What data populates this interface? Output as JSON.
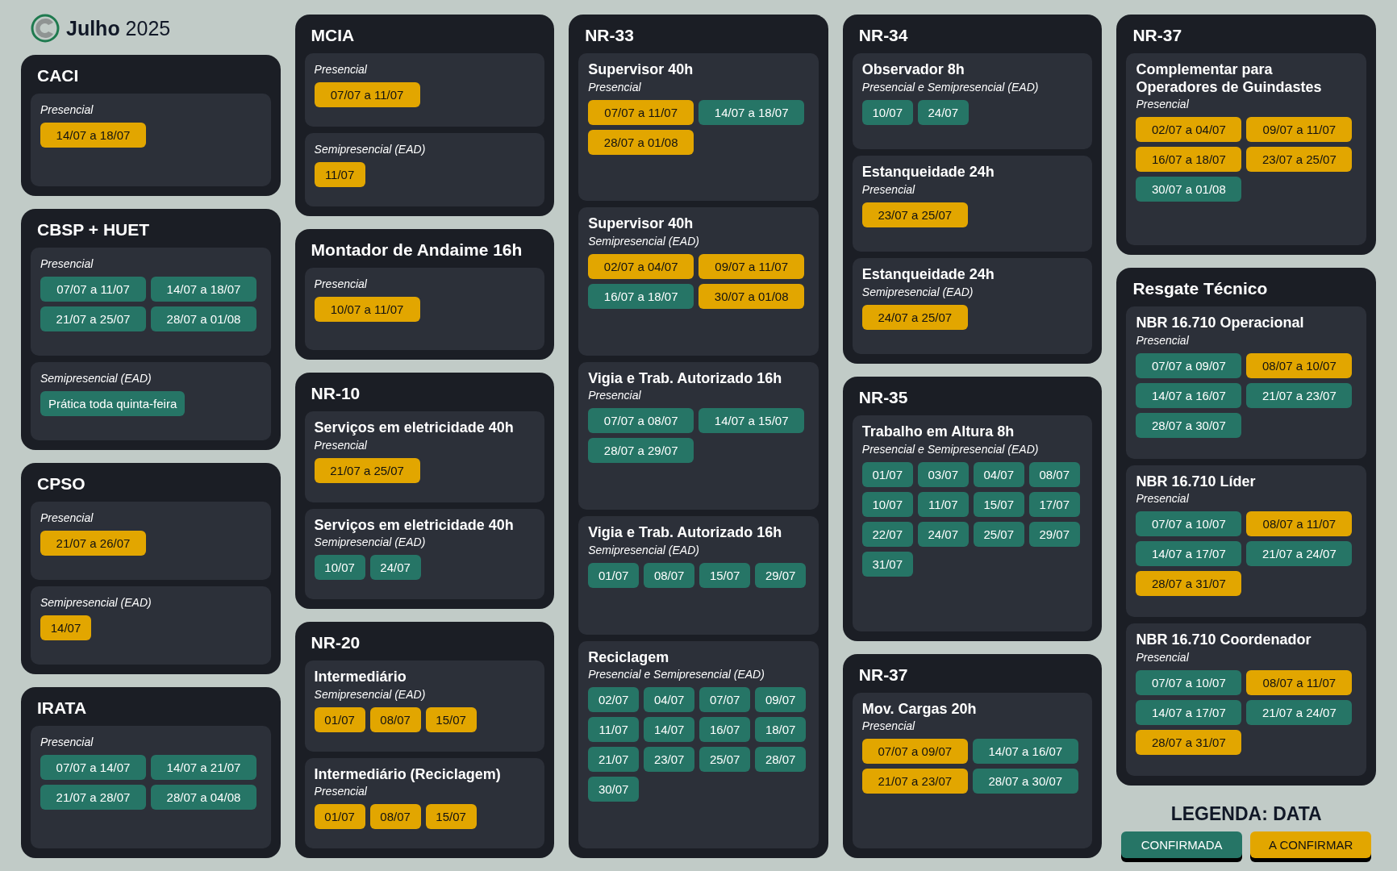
{
  "header": {
    "title": "**Julho** 2025"
  },
  "columns": [
    {
      "cards": [
        {
          "title": "CACI",
          "sections": [
            {
              "mode": "Presencial",
              "dates": [
                {
                  "text": "14/07 a 18/07",
                  "color": "#e2a600"
                }
              ]
            }
          ]
        },
        {
          "title": "CBSP + HUET",
          "sections": [
            {
              "mode": "Presencial",
              "dates": [
                {
                  "text": "07/07 a 11/07",
                  "color": "#267566"
                },
                {
                  "text": "14/07 a 18/07",
                  "color": "#267566"
                },
                {
                  "text": "21/07 a 25/07",
                  "color": "#267566"
                },
                {
                  "text": "28/07 a 01/08",
                  "color": "#267566"
                }
              ]
            },
            {
              "mode": "Semipresencial (EAD)",
              "dates": [
                {
                  "text": "Prática toda quinta-feira",
                  "color": "#267566"
                }
              ]
            }
          ]
        },
        {
          "title": "CPSO",
          "sections": [
            {
              "mode": "Presencial",
              "dates": [
                {
                  "text": "21/07 a 26/07",
                  "color": "#e2a600"
                }
              ]
            },
            {
              "mode": "Semipresencial (EAD)",
              "dates": [
                {
                  "text": "14/07",
                  "color": "#e2a600"
                }
              ]
            }
          ]
        },
        {
          "title": "IRATA",
          "sections": [
            {
              "mode": "Presencial",
              "dates": [
                {
                  "text": "07/07 a 14/07",
                  "color": "#267566"
                },
                {
                  "text": "14/07 a 21/07",
                  "color": "#267566"
                },
                {
                  "text": "21/07 a 28/07",
                  "color": "#267566"
                },
                {
                  "text": "28/07 a 04/08",
                  "color": "#267566"
                }
              ]
            }
          ]
        }
      ]
    },
    {
      "cards": [
        {
          "title": "MCIA",
          "sections": [
            {
              "mode": "Presencial",
              "dates": [
                {
                  "text": "07/07 a 11/07",
                  "color": "#e2a600"
                }
              ]
            },
            {
              "mode": "Semipresencial (EAD)",
              "dates": [
                {
                  "text": "11/07",
                  "color": "#e2a600"
                }
              ]
            }
          ]
        },
        {
          "title": "Montador de Andaime 16h",
          "sections": [
            {
              "mode": "Presencial",
              "dates": [
                {
                  "text": "10/07 a 11/07",
                  "color": "#e2a600"
                }
              ]
            }
          ]
        },
        {
          "title": "NR-10",
          "sections": [
            {
              "name": "Serviços em eletricidade 40h",
              "mode": "Presencial",
              "dates": [
                {
                  "text": "21/07 a 25/07",
                  "color": "#e2a600"
                }
              ]
            },
            {
              "name": "Serviços em eletricidade 40h",
              "mode": "Semipresencial (EAD)",
              "dates": [
                {
                  "text": "10/07",
                  "color": "#267566"
                },
                {
                  "text": "24/07",
                  "color": "#267566"
                }
              ]
            }
          ]
        },
        {
          "title": "NR-20",
          "sections": [
            {
              "name": "Intermediário",
              "mode": "Semipresencial (EAD)",
              "dates": [
                {
                  "text": "01/07",
                  "color": "#e2a600"
                },
                {
                  "text": "08/07",
                  "color": "#e2a600"
                },
                {
                  "text": "15/07",
                  "color": "#e2a600"
                }
              ]
            },
            {
              "name": "Intermediário (Reciclagem)",
              "mode": "Presencial",
              "dates": [
                {
                  "text": "01/07",
                  "color": "#e2a600"
                },
                {
                  "text": "08/07",
                  "color": "#e2a600"
                },
                {
                  "text": "15/07",
                  "color": "#e2a600"
                }
              ]
            }
          ]
        }
      ]
    },
    {
      "cards": [
        {
          "title": "NR-33",
          "sections": [
            {
              "name": "Supervisor 40h",
              "mode": "Presencial",
              "dates": [
                {
                  "text": "07/07 a 11/07",
                  "color": "#e2a600"
                },
                {
                  "text": "14/07 a 18/07",
                  "color": "#267566"
                },
                {
                  "text": "28/07 a 01/08",
                  "color": "#e2a600"
                }
              ]
            },
            {
              "name": "Supervisor 40h",
              "mode": "Semipresencial (EAD)",
              "dates": [
                {
                  "text": "02/07 a 04/07",
                  "color": "#e2a600"
                },
                {
                  "text": "09/07 a 11/07",
                  "color": "#e2a600"
                },
                {
                  "text": "16/07 a 18/07",
                  "color": "#267566"
                },
                {
                  "text": "30/07 a 01/08",
                  "color": "#e2a600"
                }
              ]
            },
            {
              "name": "Vigia e Trab. Autorizado 16h",
              "mode": "Presencial",
              "dates": [
                {
                  "text": "07/07 a 08/07",
                  "color": "#267566"
                },
                {
                  "text": "14/07 a 15/07",
                  "color": "#267566"
                },
                {
                  "text": "28/07 a 29/07",
                  "color": "#267566"
                }
              ]
            },
            {
              "name": "Vigia e Trab. Autorizado 16h",
              "mode": "Semipresencial (EAD)",
              "dates": [
                {
                  "text": "01/07",
                  "color": "#267566"
                },
                {
                  "text": "08/07",
                  "color": "#267566"
                },
                {
                  "text": "15/07",
                  "color": "#267566"
                },
                {
                  "text": "29/07",
                  "color": "#267566"
                }
              ]
            },
            {
              "name": "Reciclagem",
              "mode": "Presencial e Semipresencial (EAD)",
              "dates": [
                {
                  "text": "02/07",
                  "color": "#267566"
                },
                {
                  "text": "04/07",
                  "color": "#267566"
                },
                {
                  "text": "07/07",
                  "color": "#267566"
                },
                {
                  "text": "09/07",
                  "color": "#267566"
                },
                {
                  "text": "11/07",
                  "color": "#267566"
                },
                {
                  "text": "14/07",
                  "color": "#267566"
                },
                {
                  "text": "16/07",
                  "color": "#267566"
                },
                {
                  "text": "18/07",
                  "color": "#267566"
                },
                {
                  "text": "21/07",
                  "color": "#267566"
                },
                {
                  "text": "23/07",
                  "color": "#267566"
                },
                {
                  "text": "25/07",
                  "color": "#267566"
                },
                {
                  "text": "28/07",
                  "color": "#267566"
                },
                {
                  "text": "30/07",
                  "color": "#267566"
                }
              ]
            }
          ]
        }
      ]
    },
    {
      "cards": [
        {
          "title": "NR-34",
          "sections": [
            {
              "name": "Observador 8h",
              "mode": "Presencial e Semipresencial (EAD)",
              "dates": [
                {
                  "text": "10/07",
                  "color": "#267566"
                },
                {
                  "text": "24/07",
                  "color": "#267566"
                }
              ]
            },
            {
              "name": "Estanqueidade 24h",
              "mode": "Presencial",
              "dates": [
                {
                  "text": "23/07 a 25/07",
                  "color": "#e2a600"
                }
              ]
            },
            {
              "name": "Estanqueidade 24h",
              "mode": "Semipresencial (EAD)",
              "dates": [
                {
                  "text": "24/07 a 25/07",
                  "color": "#e2a600"
                }
              ]
            }
          ]
        },
        {
          "title": "NR-35",
          "sections": [
            {
              "name": "Trabalho em Altura 8h",
              "mode": "Presencial e Semipresencial (EAD)",
              "dates": [
                {
                  "text": "01/07",
                  "color": "#267566"
                },
                {
                  "text": "03/07",
                  "color": "#267566"
                },
                {
                  "text": "04/07",
                  "color": "#267566"
                },
                {
                  "text": "08/07",
                  "color": "#267566"
                },
                {
                  "text": "10/07",
                  "color": "#267566"
                },
                {
                  "text": "11/07",
                  "color": "#267566"
                },
                {
                  "text": "15/07",
                  "color": "#267566"
                },
                {
                  "text": "17/07",
                  "color": "#267566"
                },
                {
                  "text": "22/07",
                  "color": "#267566"
                },
                {
                  "text": "24/07",
                  "color": "#267566"
                },
                {
                  "text": "25/07",
                  "color": "#267566"
                },
                {
                  "text": "29/07",
                  "color": "#267566"
                },
                {
                  "text": "31/07",
                  "color": "#267566"
                }
              ]
            }
          ]
        },
        {
          "title": "NR-37",
          "sections": [
            {
              "name": "Mov. Cargas  20h",
              "mode": "Presencial",
              "dates": [
                {
                  "text": "07/07 a 09/07",
                  "color": "#e2a600"
                },
                {
                  "text": "14/07 a 16/07",
                  "color": "#267566"
                },
                {
                  "text": "21/07 a 23/07",
                  "color": "#e2a600"
                },
                {
                  "text": "28/07 a 30/07",
                  "color": "#267566"
                }
              ]
            }
          ]
        }
      ]
    },
    {
      "cards": [
        {
          "title": "NR-37",
          "sections": [
            {
              "name": "Complementar para Operadores de Guindastes",
              "mode": "Presencial",
              "dates": [
                {
                  "text": "02/07 a 04/07",
                  "color": "#e2a600"
                },
                {
                  "text": "09/07 a 11/07",
                  "color": "#e2a600"
                },
                {
                  "text": "16/07 a 18/07",
                  "color": "#e2a600"
                },
                {
                  "text": "23/07 a 25/07",
                  "color": "#e2a600"
                },
                {
                  "text": "30/07 a 01/08",
                  "color": "#267566"
                }
              ]
            }
          ]
        },
        {
          "title": "Resgate Técnico",
          "sections": [
            {
              "name": "NBR 16.710 Operacional",
              "mode": "Presencial",
              "dates": [
                {
                  "text": "07/07 a 09/07",
                  "color": "#267566"
                },
                {
                  "text": "08/07 a 10/07",
                  "color": "#e2a600"
                },
                {
                  "text": "14/07 a 16/07",
                  "color": "#267566"
                },
                {
                  "text": "21/07 a 23/07",
                  "color": "#267566"
                },
                {
                  "text": "28/07 a 30/07",
                  "color": "#267566"
                }
              ]
            },
            {
              "name": "NBR 16.710 Líder",
              "mode": "Presencial",
              "dates": [
                {
                  "text": "07/07 a 10/07",
                  "color": "#267566"
                },
                {
                  "text": "08/07 a 11/07",
                  "color": "#e2a600"
                },
                {
                  "text": "14/07 a 17/07",
                  "color": "#267566"
                },
                {
                  "text": "21/07 a 24/07",
                  "color": "#267566"
                },
                {
                  "text": "28/07 a 31/07",
                  "color": "#e2a600"
                }
              ]
            },
            {
              "name": "NBR 16.710 Coordenador",
              "mode": "Presencial",
              "dates": [
                {
                  "text": "07/07 a 10/07",
                  "color": "#267566"
                },
                {
                  "text": "08/07 a 11/07",
                  "color": "#e2a600"
                },
                {
                  "text": "14/07 a 17/07",
                  "color": "#267566"
                },
                {
                  "text": "21/07 a 24/07",
                  "color": "#267566"
                },
                {
                  "text": "28/07 a 31/07",
                  "color": "#e2a600"
                }
              ]
            }
          ]
        }
      ]
    }
  ],
  "legend": {
    "title": "LEGENDA: DATA",
    "items": [
      {
        "label": "CONFIRMADA",
        "color": "#267566"
      },
      {
        "label": "A CONFIRMAR",
        "color": "#e2a600"
      }
    ]
  }
}
